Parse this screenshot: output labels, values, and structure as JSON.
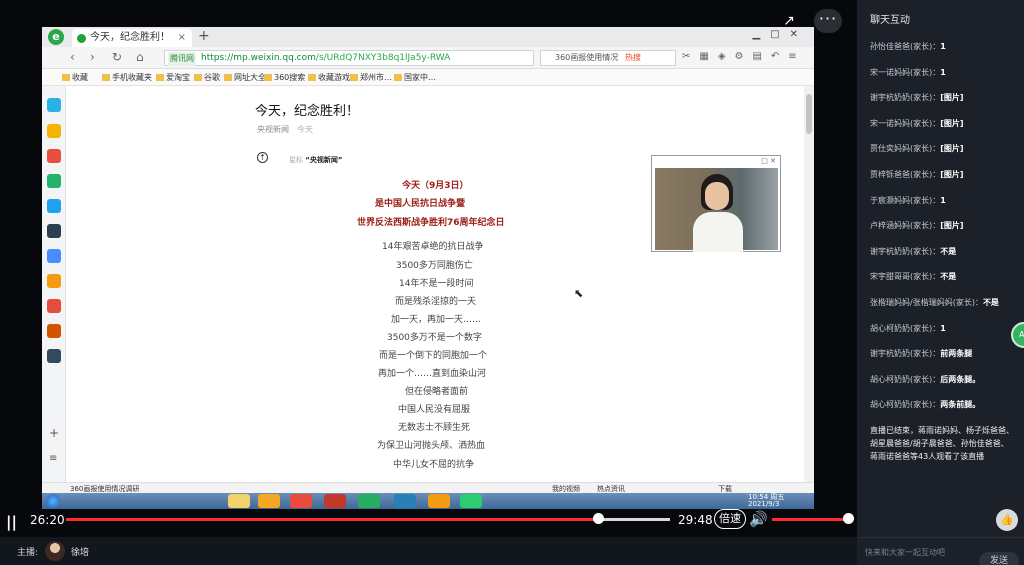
{
  "browser": {
    "tab_title": "今天，纪念胜利！",
    "url_host": "https://mp.weixin.qq.com",
    "url_path": "/s/URdQ7NXY3b8q1lJa5y-RWA",
    "url_badge": "腾讯网",
    "search_text": "360画报使用情况",
    "search_hot": "热搜",
    "bookmarks": [
      "收藏",
      "手机收藏夹",
      "爱淘宝",
      "谷歌",
      "网址大全",
      "360搜索",
      "收藏游戏",
      "郑州市…",
      "国家中…"
    ],
    "status_left": "360画报使用情况调研",
    "status_items": [
      "我的视频",
      "热点资讯",
      "下载"
    ],
    "clock_time": "10:54 周五",
    "clock_date": "2021/9/3"
  },
  "article": {
    "title": "今天，纪念胜利！",
    "source": "央视新闻",
    "date": "今天",
    "star_prefix": "星标",
    "star_name": "“央视新闻”",
    "red_lines": [
      "今天（9月3日）",
      "是中国人民抗日战争暨",
      "世界反法西斯战争胜利76周年纪念日"
    ],
    "lines": [
      "14年艰苦卓绝的抗日战争",
      "3500多万同胞伤亡",
      "14年不是一段时间",
      "而是残杀淫掠的一天",
      "加一天，再加一天……",
      "3500多万不是一个数字",
      "而是一个倒下的同胞加一个",
      "再加一个……直到血染山河",
      "但在侵略者面前",
      "中国人民没有屈服",
      "无数志士不顾生死",
      "为保卫山河抛头颅、洒热血",
      "中华儿女不屈的抗争"
    ]
  },
  "player": {
    "current_time": "26:20",
    "duration": "29:48",
    "speed_label": "倍速",
    "progress": 0.884
  },
  "host": {
    "label": "主播:",
    "name": "徐培"
  },
  "chat": {
    "title": "聊天互动",
    "messages": [
      {
        "user": "孙怡佳爸爸(家长)：",
        "text": "1"
      },
      {
        "user": "宋一诺妈妈(家长)：",
        "text": "1"
      },
      {
        "user": "谢宇杭奶奶(家长)：",
        "text": "[图片]"
      },
      {
        "user": "宋一诺妈妈(家长)：",
        "text": "[图片]"
      },
      {
        "user": "贾仕奕妈妈(家长)：",
        "text": "[图片]"
      },
      {
        "user": "贾梓铄爸爸(家长)：",
        "text": "[图片]"
      },
      {
        "user": "于宸灏妈妈(家长)：",
        "text": "1"
      },
      {
        "user": "卢梓涵妈妈(家长)：",
        "text": "[图片]"
      },
      {
        "user": "谢宇杭奶奶(家长)：",
        "text": "不是"
      },
      {
        "user": "宋宇甜哥哥(家长)：",
        "text": "不是"
      },
      {
        "user": "张楷瑞妈妈/张楷瑞妈妈(家长)：",
        "text": "不是"
      },
      {
        "user": "胡心柯奶奶(家长)：",
        "text": "1"
      },
      {
        "user": "谢宇杭奶奶(家长)：",
        "text": "前两条腿"
      },
      {
        "user": "胡心柯奶奶(家长)：",
        "text": "后两条腿。"
      },
      {
        "user": "胡心柯奶奶(家长)：",
        "text": "两条前腿。"
      }
    ],
    "notice": "直播已结束，蒋雨诺妈妈、杨子烁爸爸、胡星晨爸爸/胡子晨爸爸、孙怡佳爸爸、蒋雨诺爸爸等43人观看了该直播",
    "input_placeholder": "快来和大家一起互动吧",
    "send_label": "发送",
    "badge": "A"
  },
  "colors": {
    "accent": "#fe2c2c",
    "title_red": "#9b1b13",
    "chat_bg": "#1b2029"
  }
}
